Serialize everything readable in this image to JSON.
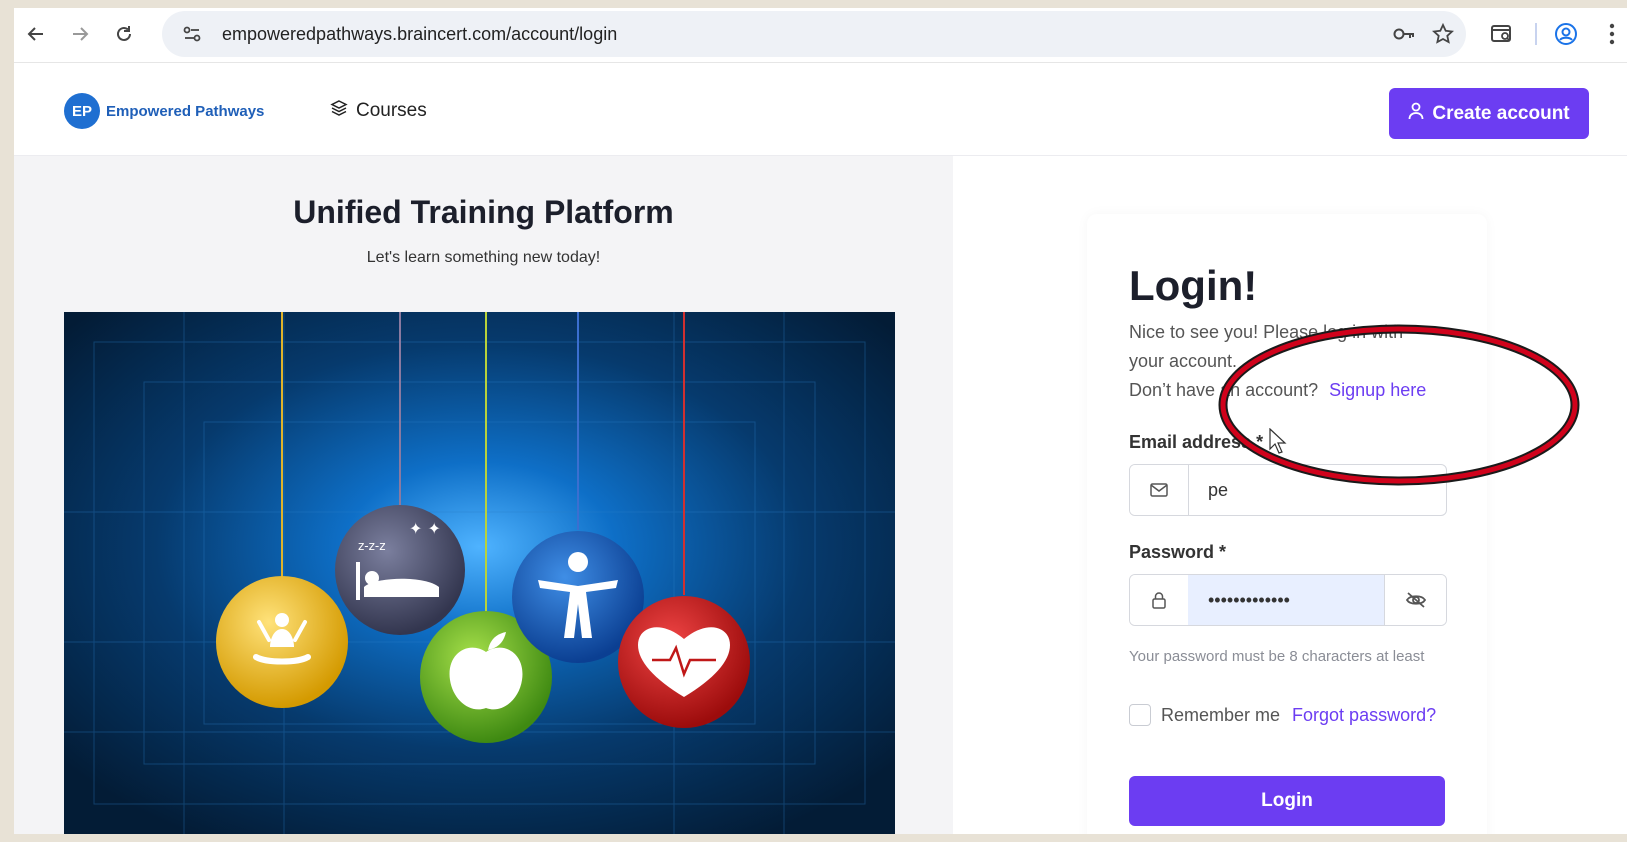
{
  "browser": {
    "url": "empoweredpathways.braincert.com/account/login",
    "icons": [
      "back-arrow-icon",
      "forward-arrow-icon",
      "reload-icon",
      "site-settings-icon",
      "password-key-icon",
      "bookmark-star-icon",
      "tab-search-icon",
      "profile-icon",
      "menu-dots-icon"
    ]
  },
  "header": {
    "logo_badge": "EP",
    "logo_text": "Empowered Pathways",
    "courses_label": "Courses",
    "create_account_label": "Create account"
  },
  "hero": {
    "title": "Unified Training Platform",
    "subtitle": "Let's learn something new today!"
  },
  "login": {
    "title": "Login!",
    "intro": "Nice to see you! Please log in with your account.",
    "no_account": "Don’t have an account?",
    "signup_link": "Signup here",
    "email_label": "Email address *",
    "email_value": "pe",
    "password_label": "Password *",
    "password_value": "•••••••••••••",
    "password_hint": "Your password must be 8 characters at least",
    "remember_label": "Remember me",
    "forgot_label": "Forgot password?",
    "submit_label": "Login"
  },
  "colors": {
    "accent": "#6c3df2",
    "annotation": "#d0021b"
  }
}
